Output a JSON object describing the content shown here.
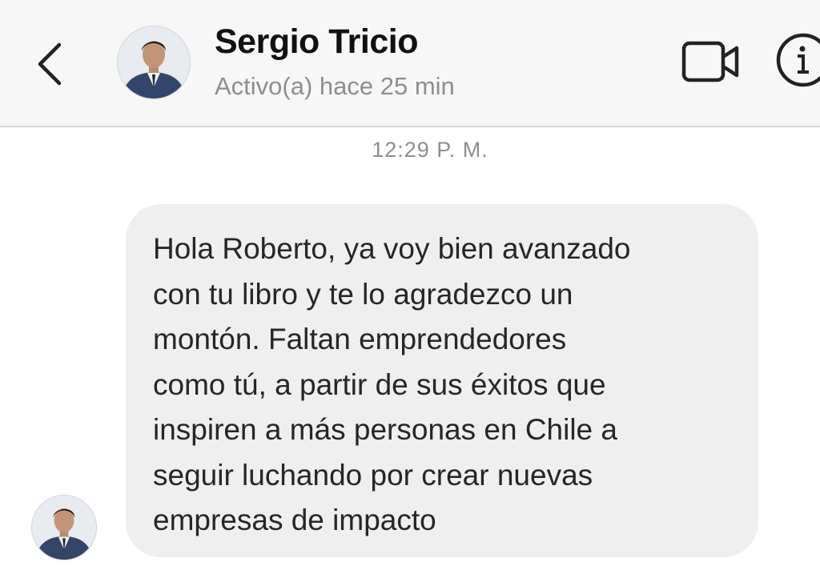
{
  "header": {
    "contact_name": "Sergio Tricio",
    "status": "Activo(a) hace 25 min",
    "icons": {
      "back": "chevron-left-icon",
      "video_call": "video-camera-icon",
      "info": "info-icon"
    }
  },
  "conversation": {
    "timestamp": "12:29 P. M.",
    "messages": [
      {
        "sender": "Sergio Tricio",
        "text": "Hola Roberto, ya voy bien avanzado\ncon tu libro y te lo agradezco un\nmontón. Faltan emprendedores\ncomo tú, a partir de sus éxitos que\ninspiren a más personas en Chile a\nseguir luchando por crear nuevas\nempresas de impacto"
      }
    ]
  },
  "colors": {
    "header_bg": "#f7f7f7",
    "bubble_bg": "#efefef",
    "secondary_text": "#8e8e8e",
    "primary_text": "#111111"
  }
}
